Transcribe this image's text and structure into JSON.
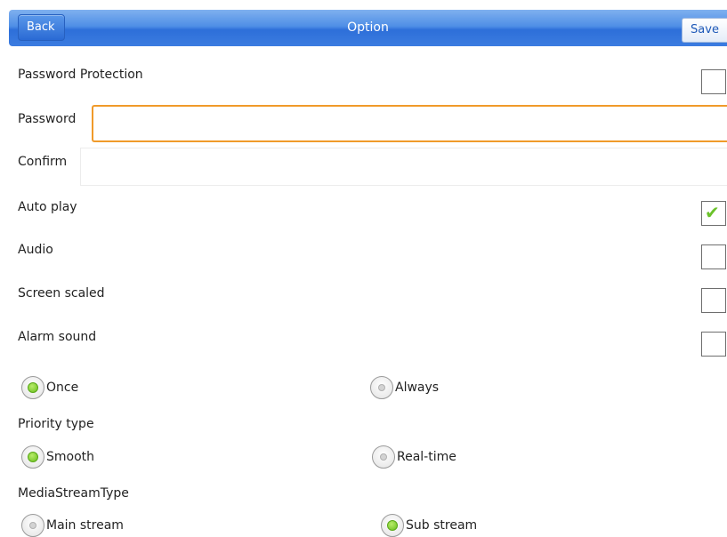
{
  "header": {
    "title": "Option",
    "back_label": "Back",
    "save_label": "Save"
  },
  "settings": {
    "password_protection": {
      "label": "Password Protection",
      "checked": false
    },
    "password": {
      "label": "Password",
      "value": ""
    },
    "confirm": {
      "label": "Confirm",
      "value": ""
    },
    "auto_play": {
      "label": "Auto play",
      "checked": true
    },
    "audio": {
      "label": "Audio",
      "checked": false
    },
    "screen_scaled": {
      "label": "Screen scaled",
      "checked": false
    },
    "alarm_sound": {
      "label": "Alarm sound",
      "checked": false
    }
  },
  "alarm_mode": {
    "options": [
      {
        "label": "Once",
        "selected": true
      },
      {
        "label": "Always",
        "selected": false
      }
    ]
  },
  "priority_type": {
    "label": "Priority type",
    "options": [
      {
        "label": "Smooth",
        "selected": true
      },
      {
        "label": "Real-time",
        "selected": false
      }
    ]
  },
  "media_stream_type": {
    "label": "MediaStreamType",
    "options": [
      {
        "label": "Main stream",
        "selected": false
      },
      {
        "label": "Sub stream",
        "selected": true
      }
    ]
  },
  "colors": {
    "accent_blue": "#2d6fd9",
    "focus_orange": "#f09a2a",
    "check_green": "#6bc22a"
  }
}
